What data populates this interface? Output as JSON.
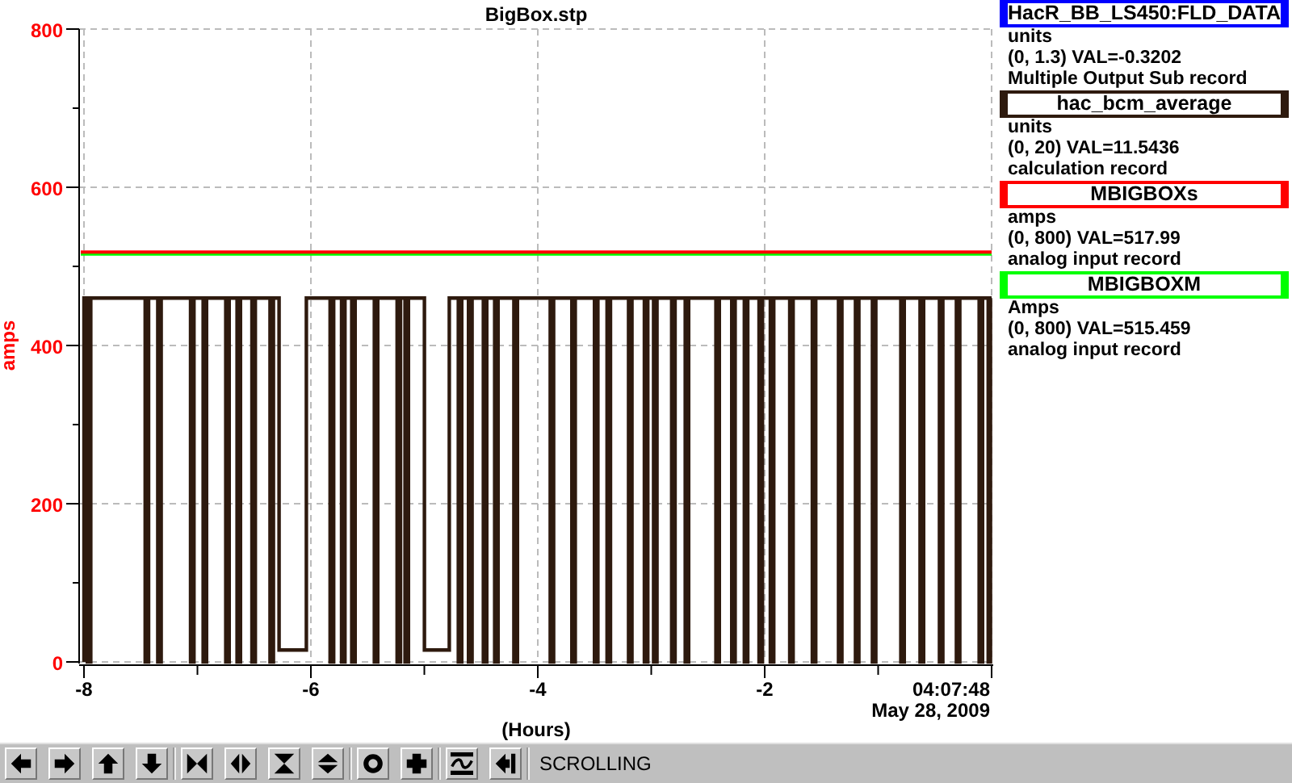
{
  "plot": {
    "chart_data": {
      "type": "line",
      "title": "BigBox.stp",
      "xlabel": "(Hours)",
      "ylabel": "amps",
      "xlim": [
        -8,
        0
      ],
      "ylim": [
        0,
        800
      ],
      "xticks": [
        -8,
        -6,
        -4,
        -2
      ],
      "yticks": [
        0,
        200,
        400,
        600,
        800
      ],
      "x": [
        -8,
        -8,
        -7.97,
        -7.97,
        -7.94,
        -7.94,
        -7.46,
        -7.46,
        -7.43,
        -7.43,
        -7.35,
        -7.35,
        -7.32,
        -7.32,
        -7.06,
        -7.06,
        -7.03,
        -7.03,
        -6.95,
        -6.95,
        -6.92,
        -6.92,
        -6.75,
        -6.75,
        -6.72,
        -6.72,
        -6.65,
        -6.65,
        -6.62,
        -6.62,
        -6.52,
        -6.52,
        -6.49,
        -6.49,
        -6.36,
        -6.36,
        -6.33,
        -6.33,
        -6.28,
        -6.28,
        -6.04,
        -6.04,
        -5.83,
        -5.83,
        -5.8,
        -5.8,
        -5.73,
        -5.73,
        -5.7,
        -5.7,
        -5.64,
        -5.64,
        -5.61,
        -5.61,
        -5.44,
        -5.44,
        -5.41,
        -5.41,
        -5.24,
        -5.24,
        -5.21,
        -5.21,
        -5.17,
        -5.17,
        -5.14,
        -5.14,
        -5,
        -5,
        -4.78,
        -4.78,
        -4.7,
        -4.7,
        -4.67,
        -4.67,
        -4.61,
        -4.61,
        -4.58,
        -4.58,
        -4.48,
        -4.48,
        -4.45,
        -4.45,
        -4.38,
        -4.38,
        -4.35,
        -4.35,
        -4.21,
        -4.21,
        -4.18,
        -4.18,
        -3.89,
        -3.89,
        -3.86,
        -3.86,
        -3.7,
        -3.7,
        -3.67,
        -3.67,
        -3.5,
        -3.5,
        -3.47,
        -3.47,
        -3.39,
        -3.39,
        -3.36,
        -3.36,
        -3.2,
        -3.2,
        -3.17,
        -3.17,
        -3.06,
        -3.06,
        -3.03,
        -3.03,
        -2.98,
        -2.98,
        -2.95,
        -2.95,
        -2.82,
        -2.82,
        -2.79,
        -2.79,
        -2.7,
        -2.7,
        -2.67,
        -2.67,
        -2.43,
        -2.43,
        -2.4,
        -2.4,
        -2.29,
        -2.29,
        -2.26,
        -2.26,
        -2.18,
        -2.18,
        -2.15,
        -2.15,
        -2.05,
        -2.05,
        -2.02,
        -2.02,
        -1.95,
        -1.95,
        -1.92,
        -1.92,
        -1.78,
        -1.78,
        -1.75,
        -1.75,
        -1.58,
        -1.58,
        -1.55,
        -1.55,
        -1.35,
        -1.35,
        -1.32,
        -1.32,
        -1.2,
        -1.2,
        -1.17,
        -1.17,
        -1.05,
        -1.05,
        -1.02,
        -1.02,
        -0.8,
        -0.8,
        -0.77,
        -0.77,
        -0.63,
        -0.63,
        -0.6,
        -0.6,
        -0.46,
        -0.46,
        -0.43,
        -0.43,
        -0.31,
        -0.31,
        -0.28,
        -0.28,
        -0.11,
        -0.11,
        -0.08,
        -0.08,
        -0.03,
        -0.03,
        -0.01,
        -0.01,
        0
      ],
      "series": [
        {
          "color": "#2e1a0e",
          "values": [
            0,
            460,
            460,
            0,
            0,
            460,
            460,
            0,
            0,
            460,
            460,
            0,
            0,
            460,
            460,
            0,
            0,
            460,
            460,
            0,
            0,
            460,
            460,
            0,
            0,
            460,
            460,
            0,
            0,
            460,
            460,
            0,
            0,
            460,
            460,
            0,
            0,
            460,
            460,
            15,
            15,
            460,
            460,
            0,
            0,
            460,
            460,
            0,
            0,
            460,
            460,
            0,
            0,
            460,
            460,
            0,
            0,
            460,
            460,
            0,
            0,
            460,
            460,
            0,
            0,
            460,
            460,
            15,
            15,
            460,
            460,
            0,
            0,
            460,
            460,
            0,
            0,
            460,
            460,
            0,
            0,
            460,
            460,
            0,
            0,
            460,
            460,
            0,
            0,
            460,
            460,
            0,
            0,
            460,
            460,
            0,
            0,
            460,
            460,
            0,
            0,
            460,
            460,
            0,
            0,
            460,
            460,
            0,
            0,
            460,
            460,
            0,
            0,
            460,
            460,
            0,
            0,
            460,
            460,
            0,
            0,
            460,
            460,
            0,
            0,
            460,
            460,
            0,
            0,
            460,
            460,
            0,
            0,
            460,
            460,
            0,
            0,
            460,
            460,
            0,
            0,
            460,
            460,
            0,
            0,
            460,
            460,
            0,
            0,
            460,
            460,
            0,
            0,
            460,
            460,
            0,
            0,
            460,
            460,
            0,
            0,
            460,
            460,
            0,
            0,
            460,
            460,
            0,
            0,
            460,
            460,
            0,
            0,
            460,
            460,
            0,
            0,
            460,
            460,
            0,
            0,
            460,
            460,
            0,
            0,
            460,
            460,
            0,
            0,
            460,
            460
          ]
        }
      ],
      "ref_lines": [
        {
          "axis": "y",
          "value": 515.459,
          "color": "#00ff00"
        },
        {
          "axis": "y",
          "value": 517.99,
          "color": "#ff0000"
        }
      ],
      "grid": true
    },
    "end_time": "04:07:48",
    "end_date": "May 28, 2009"
  },
  "legend": [
    {
      "name": "HacR_BB_LS450:FLD_DATA",
      "color": "#0000ff",
      "units": "units",
      "range_value": "(0, 1.3) VAL=-0.3202",
      "record_type": "Multiple Output Sub record"
    },
    {
      "name": "hac_bcm_average",
      "color": "#2e1a0e",
      "units": "units",
      "range_value": "(0, 20) VAL=11.5436",
      "record_type": "calculation record"
    },
    {
      "name": "MBIGBOXs",
      "color": "#ff0000",
      "units": "amps",
      "range_value": "(0, 800) VAL=517.99",
      "record_type": "analog input record"
    },
    {
      "name": "MBIGBOXM",
      "color": "#00ff00",
      "units": "Amps",
      "range_value": "(0, 800) VAL=515.459",
      "record_type": "analog input record"
    }
  ],
  "toolbar": {
    "groups": [
      [
        {
          "kind": "left"
        },
        {
          "kind": "right"
        },
        {
          "kind": "up"
        },
        {
          "kind": "down"
        }
      ],
      [
        {
          "kind": "squeeze-x"
        },
        {
          "kind": "stretch-x"
        },
        {
          "kind": "squeeze-y"
        },
        {
          "kind": "stretch-y"
        }
      ],
      [
        {
          "kind": "ring"
        },
        {
          "kind": "plus"
        }
      ],
      [
        {
          "kind": "wave"
        },
        {
          "kind": "back"
        }
      ]
    ],
    "mode": "SCROLLING"
  }
}
